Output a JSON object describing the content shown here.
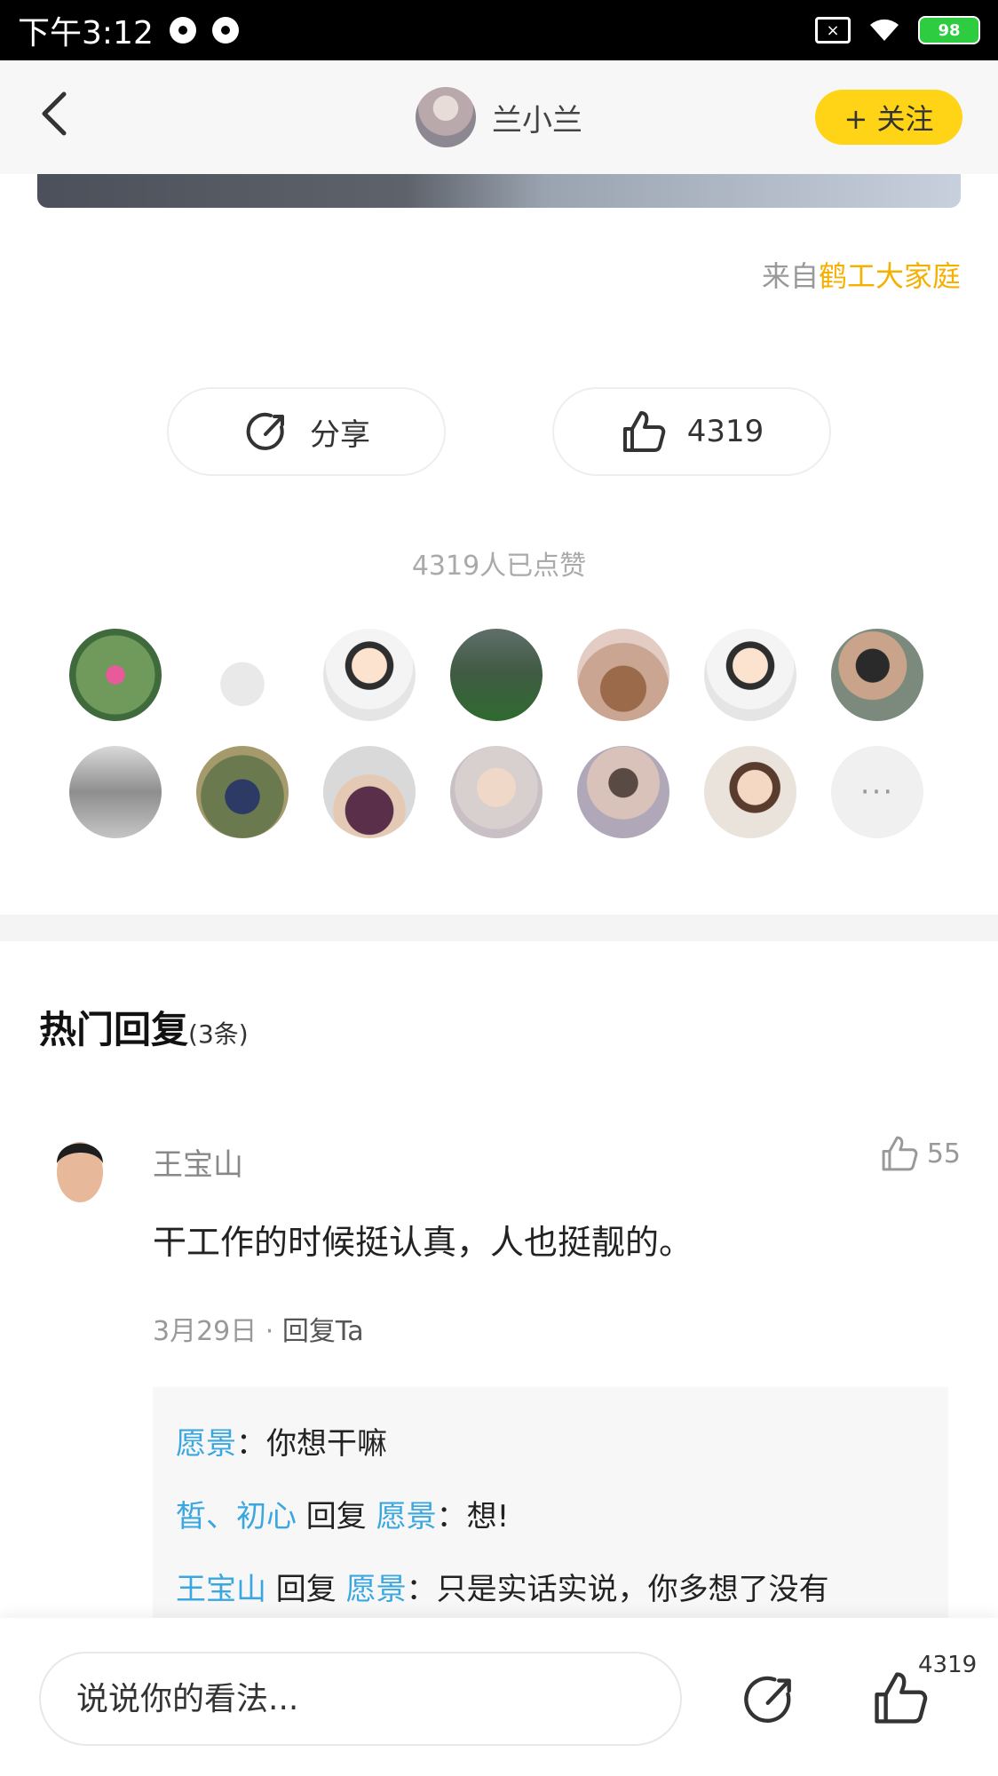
{
  "status_bar": {
    "time": "下午3:12",
    "battery": "98"
  },
  "header": {
    "author_name": "兰小兰",
    "follow_label": "+ 关注"
  },
  "post": {
    "source_prefix": "来自",
    "source_group": "鹤工大家庭"
  },
  "actions": {
    "share_label": "分享",
    "like_count": "4319"
  },
  "likes": {
    "summary": "4319人已点赞",
    "more_label": "···"
  },
  "colors": {
    "accent_yellow": "#ffd416",
    "source_orange": "#f5b000",
    "reply_name_blue": "#3aa7e0"
  },
  "hot_replies": {
    "title": "热门回复",
    "count_label": "(3条)",
    "comment": {
      "user": "王宝山",
      "like_count": "55",
      "text": "干工作的时候挺认真，人也挺靓的。",
      "date": "3月29日",
      "separator": " · ",
      "reply_label": "回复Ta",
      "replies": [
        {
          "from": "愿景",
          "text": "：你想干嘛"
        },
        {
          "from": "皙、初心",
          "mid": " 回复 ",
          "to": "愿景",
          "text": "：想!"
        },
        {
          "from": "王宝山",
          "mid": " 回复 ",
          "to": "愿景",
          "text": "：只是实话实说，你多想了没有"
        }
      ]
    }
  },
  "bottom_bar": {
    "input_placeholder": "说说你的看法...",
    "like_count": "4319"
  }
}
